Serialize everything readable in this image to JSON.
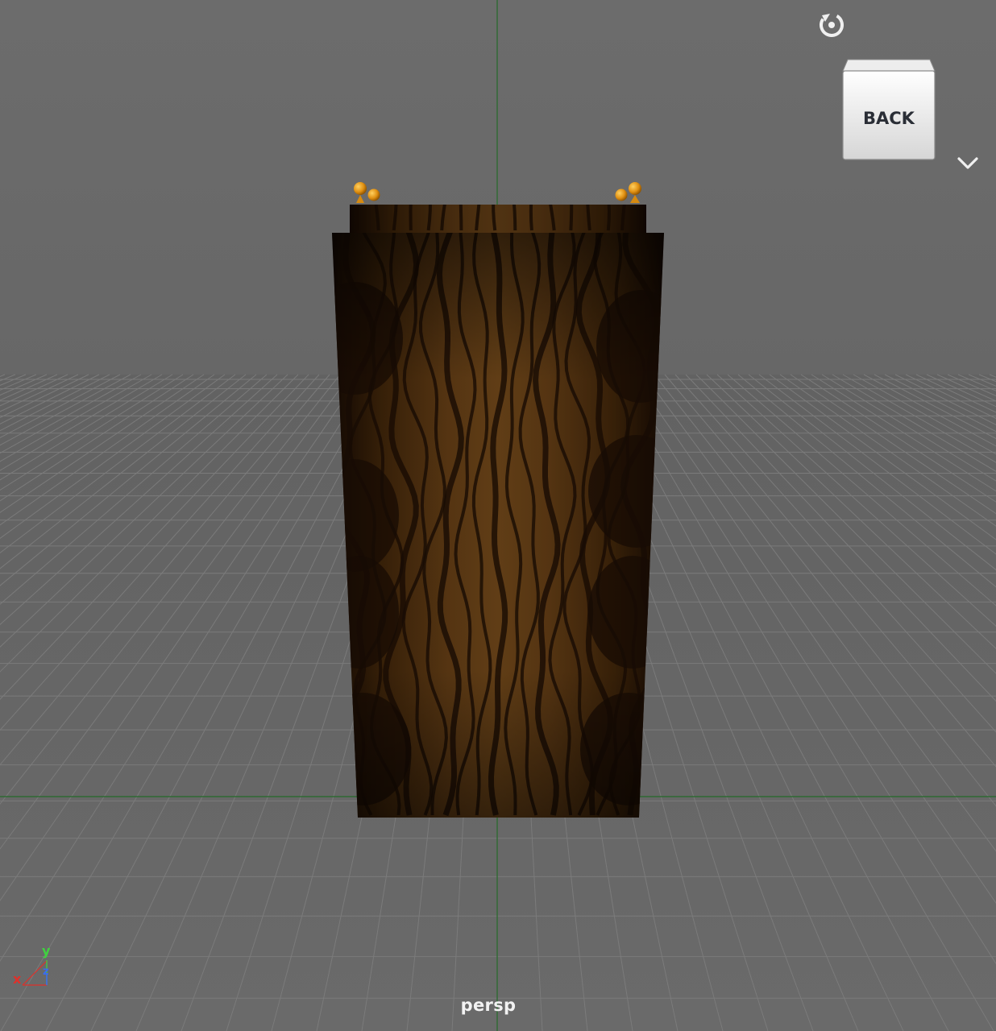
{
  "viewport": {
    "camera_name": "persp",
    "background_color": "#6b6b6b",
    "grid_color": "#7a7a7a",
    "axis_line_color": "#2e6b32"
  },
  "view_cube": {
    "face_label": "BACK",
    "rotate_icon": "rotate-icon",
    "menu_icon": "chevron-down-icon"
  },
  "axis_gizmo": {
    "x_label": "x",
    "y_label": "y",
    "z_label": "z",
    "x_color": "#e0302a",
    "y_color": "#3fd23f",
    "z_color": "#3a6cf0"
  },
  "scene_object": {
    "material": "wood-grain",
    "wood_dark": "#1a0c04",
    "wood_light": "#6b4418"
  }
}
